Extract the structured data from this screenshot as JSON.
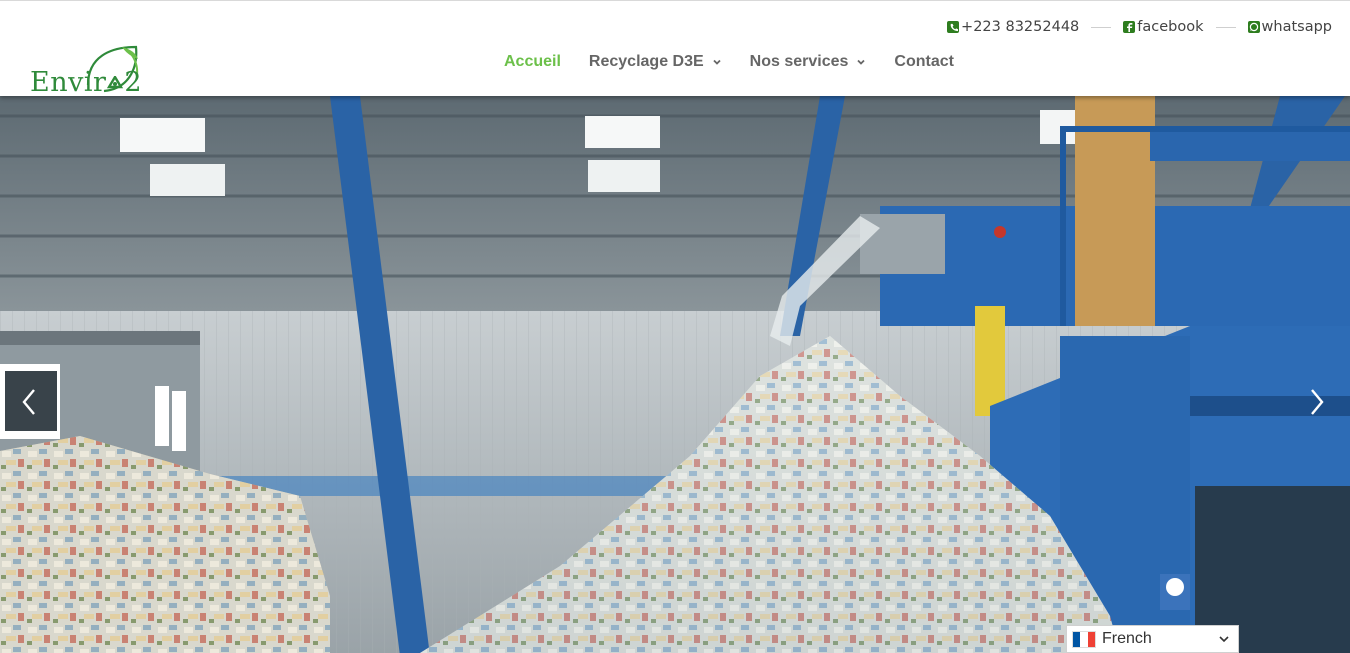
{
  "brand": {
    "logo_text": "Envir",
    "logo_suffix": "2",
    "green": "#2f8a3a",
    "accent": "#6cc04a"
  },
  "topbar": {
    "phone_icon": "phone-icon",
    "phone": "+223 83252448",
    "facebook_icon": "facebook-icon",
    "facebook": "facebook",
    "whatsapp_icon": "whatsapp-icon",
    "whatsapp": "whatsapp"
  },
  "nav": {
    "items": [
      {
        "label": "Accueil",
        "active": true,
        "dropdown": false
      },
      {
        "label": "Recyclage D3E",
        "active": false,
        "dropdown": true
      },
      {
        "label": "Nos services",
        "active": false,
        "dropdown": true
      },
      {
        "label": "Contact",
        "active": false,
        "dropdown": false
      }
    ]
  },
  "hero": {
    "image": "recycling-warehouse-photo",
    "prev_icon": "chevron-left-icon",
    "next_icon": "chevron-right-icon"
  },
  "language": {
    "label": "French",
    "flag": "france-flag",
    "flag_colors": [
      "#0055a4",
      "#ffffff",
      "#ef4135"
    ]
  }
}
